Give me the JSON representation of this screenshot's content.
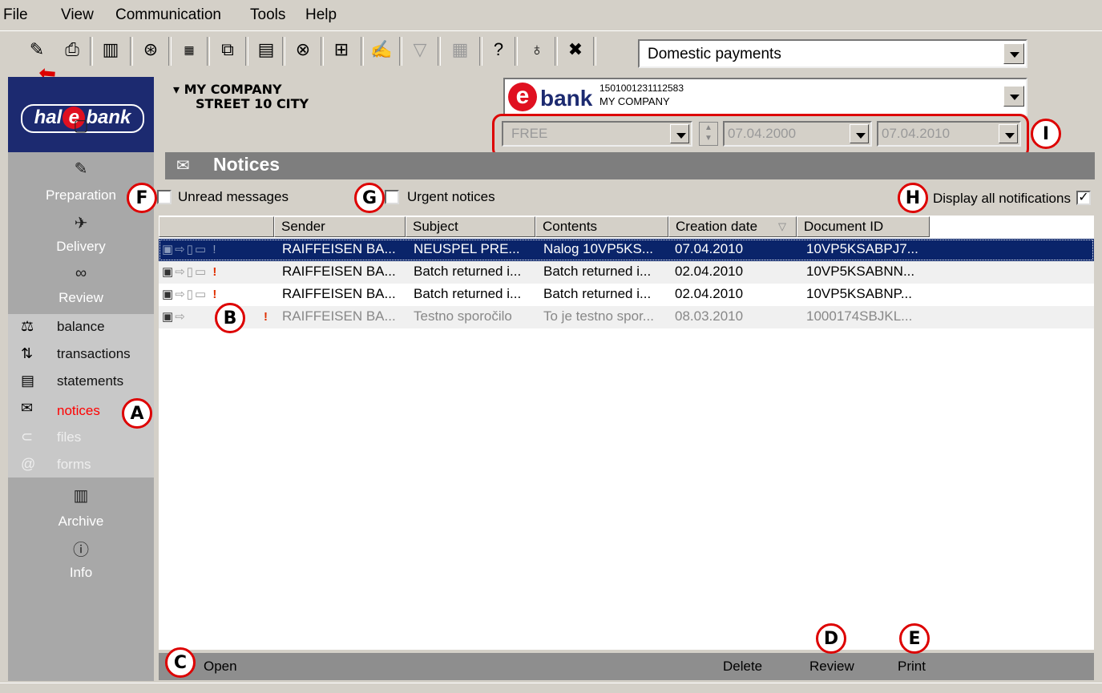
{
  "menu": [
    "File",
    "View",
    "Communication",
    "Tools",
    "Help"
  ],
  "toolbar": {
    "payment_type": "Domestic payments"
  },
  "company": {
    "name": "MY COMPANY",
    "address": "STREET 10 CITY"
  },
  "account": {
    "number": "1501001231112583",
    "owner": "MY COMPANY",
    "logo_e": "e",
    "logo_bank": "bank"
  },
  "filter": {
    "period": "FREE",
    "date_from": "07.04.2000",
    "date_to": "07.04.2010"
  },
  "logo": {
    "text": "hal e bank"
  },
  "sidebar": {
    "preparation": "Preparation",
    "delivery": "Delivery",
    "review": "Review",
    "items": [
      {
        "label": "balance",
        "icon": "balance-icon"
      },
      {
        "label": "transactions",
        "icon": "transactions-icon"
      },
      {
        "label": "statements",
        "icon": "statements-icon"
      },
      {
        "label": "notices",
        "icon": "envelope-icon"
      },
      {
        "label": "files",
        "icon": "files-icon"
      },
      {
        "label": "forms",
        "icon": "forms-icon"
      }
    ],
    "archive": "Archive",
    "info": "Info"
  },
  "section": {
    "title": "Notices"
  },
  "options": {
    "unread": "Unread messages",
    "urgent": "Urgent notices",
    "display_all": "Display all notifications",
    "display_all_checked": "✓"
  },
  "table": {
    "headers": [
      "Sender",
      "Subject",
      "Contents",
      "Creation date",
      "Document ID"
    ],
    "rows": [
      {
        "sender": "RAIFFEISEN BA...",
        "subject": "NEUSPEL PRE...",
        "contents": "Nalog 10VP5KS...",
        "date": "07.04.2010",
        "doc_id": "10VP5KSABPJ7..."
      },
      {
        "sender": "RAIFFEISEN BA...",
        "subject": "Batch returned i...",
        "contents": "Batch returned i...",
        "date": "02.04.2010",
        "doc_id": "10VP5KSABNN..."
      },
      {
        "sender": "RAIFFEISEN BA...",
        "subject": "Batch returned i...",
        "contents": "Batch returned i...",
        "date": "02.04.2010",
        "doc_id": "10VP5KSABNP..."
      },
      {
        "sender": "RAIFFEISEN BA...",
        "subject": "Testno sporočilo",
        "contents": "To je testno spor...",
        "date": "08.03.2010",
        "doc_id": "1000174SBJKL..."
      }
    ]
  },
  "footer": {
    "open": "Open",
    "delete": "Delete",
    "review": "Review",
    "print": "Print"
  },
  "annotations": {
    "a": "A",
    "b": "B",
    "c": "C",
    "d": "D",
    "e": "E",
    "f": "F",
    "g": "G",
    "h": "H",
    "i": "I"
  },
  "colors": {
    "selected_row": "#0a246a",
    "logo_bg": "#1c2a70",
    "active_item": "#ff0000",
    "marker": "#dd0000"
  }
}
